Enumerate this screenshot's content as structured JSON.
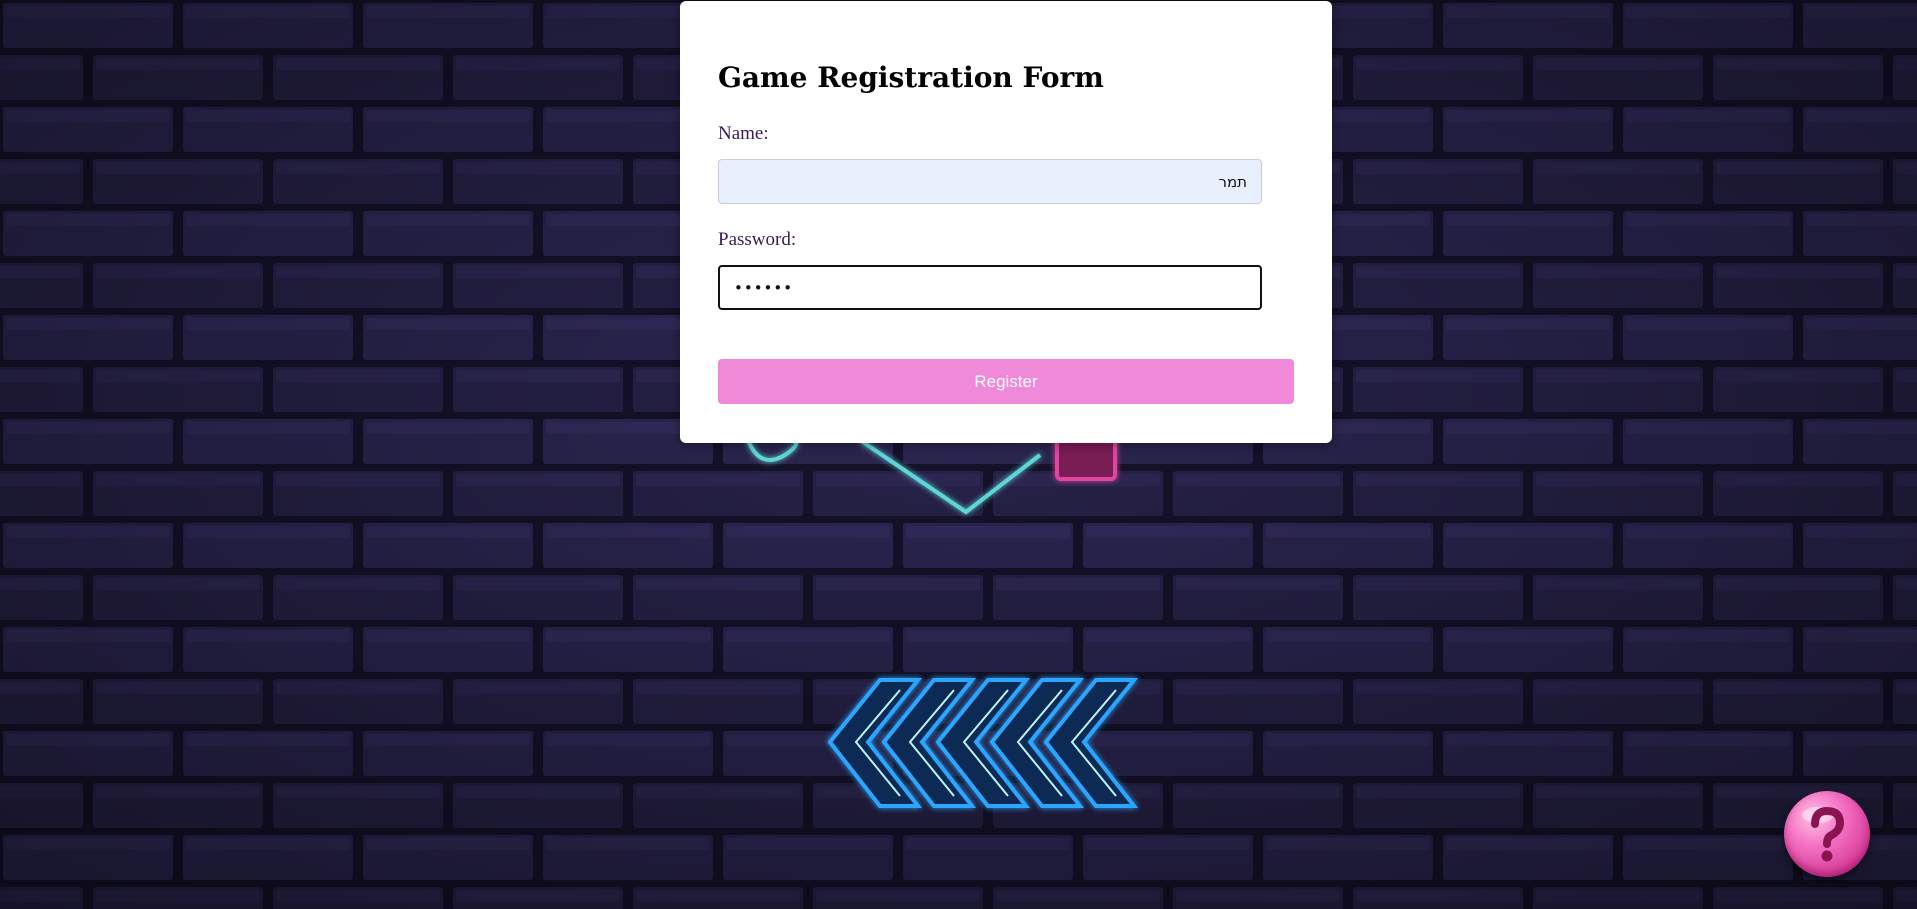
{
  "form": {
    "title": "Game Registration Form",
    "name_label": "Name:",
    "name_value": "תמר",
    "password_label": "Password:",
    "password_value": "••••••",
    "register_label": "Register"
  },
  "help": {
    "icon": "question-mark-icon"
  },
  "background": {
    "theme": "neon-brick-wall",
    "decorations": [
      "neon-diamond-outline",
      "neon-chevron-arrows-left"
    ]
  },
  "colors": {
    "wall": "#1c1838",
    "brick": "#2a2550",
    "register_button": "#f08ad8",
    "help_button": "#e8559f",
    "neon_cyan": "#5fd6d6",
    "neon_blue": "#2aa6ff",
    "neon_pink": "#e0449e"
  }
}
